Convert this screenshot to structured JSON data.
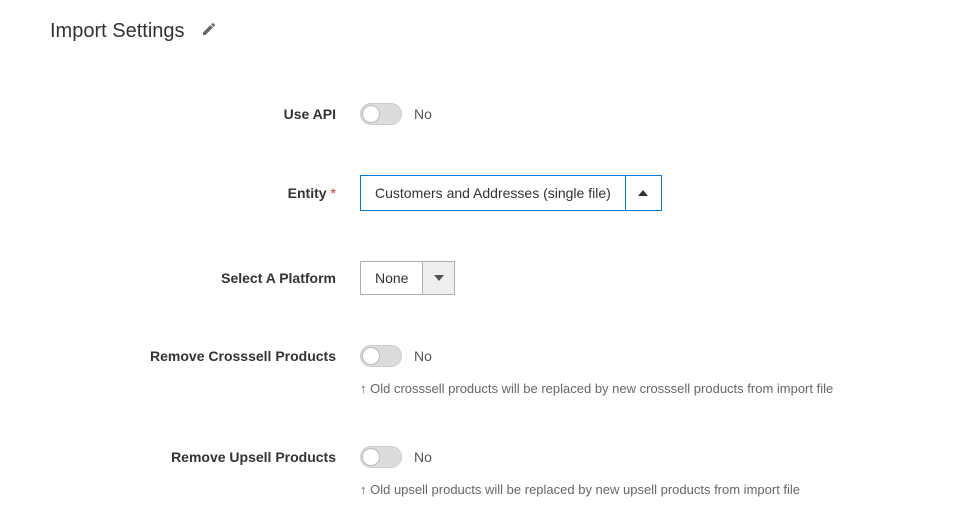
{
  "section": {
    "title": "Import Settings"
  },
  "fields": {
    "use_api": {
      "label": "Use API",
      "value": "No"
    },
    "entity": {
      "label": "Entity",
      "value": "Customers and Addresses (single file)"
    },
    "platform": {
      "label": "Select A Platform",
      "value": "None"
    },
    "remove_crosssell": {
      "label": "Remove Crosssell Products",
      "value": "No",
      "help": "↑ Old crosssell products will be replaced by new crosssell products from import file"
    },
    "remove_upsell": {
      "label": "Remove Upsell Products",
      "value": "No",
      "help": "↑ Old upsell products will be replaced by new upsell products from import file"
    }
  }
}
